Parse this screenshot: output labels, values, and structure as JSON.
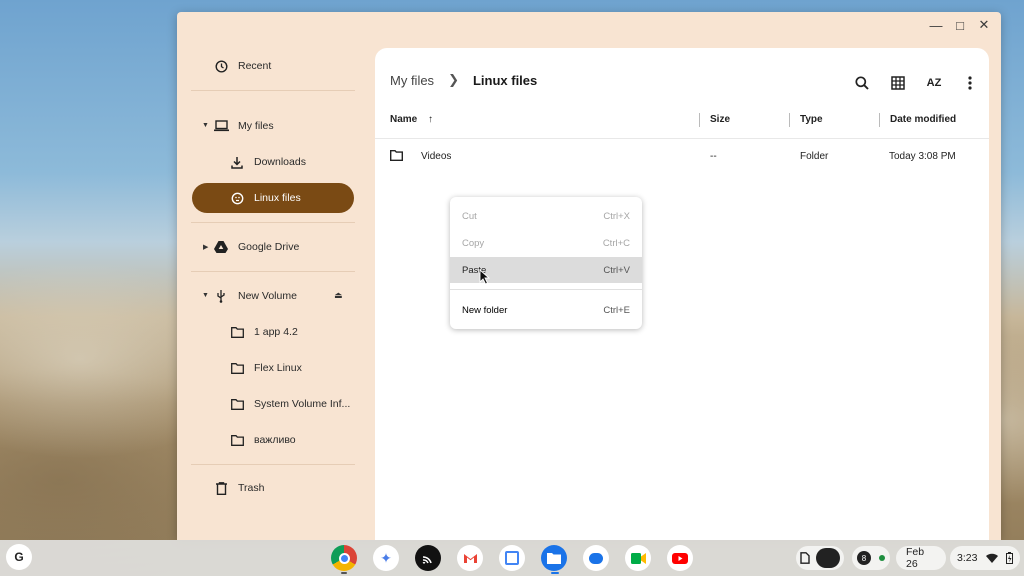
{
  "sidebar": {
    "recent": "Recent",
    "my_files": "My files",
    "downloads": "Downloads",
    "linux_files": "Linux files",
    "google_drive": "Google Drive",
    "new_volume": "New Volume",
    "volume_items": [
      "1 app 4.2",
      "Flex Linux",
      "System Volume Inf...",
      "важливо"
    ],
    "trash": "Trash"
  },
  "breadcrumb": {
    "root": "My files",
    "current": "Linux files"
  },
  "toolbar": {
    "sort_label": "AZ"
  },
  "columns": {
    "name": "Name",
    "size": "Size",
    "type": "Type",
    "date": "Date modified"
  },
  "rows": [
    {
      "name": "Videos",
      "size": "--",
      "type": "Folder",
      "date": "Today 3:08 PM"
    }
  ],
  "context_menu": {
    "cut": {
      "label": "Cut",
      "shortcut": "Ctrl+X"
    },
    "copy": {
      "label": "Copy",
      "shortcut": "Ctrl+C"
    },
    "paste": {
      "label": "Paste",
      "shortcut": "Ctrl+V"
    },
    "new_folder": {
      "label": "New folder",
      "shortcut": "Ctrl+E"
    }
  },
  "shelf": {
    "launcher": "G",
    "notification_count": "8",
    "date": "Feb 26",
    "time": "3:23"
  },
  "colors": {
    "active_item": "#7a4a14",
    "window_bg": "#f8e4d2"
  }
}
